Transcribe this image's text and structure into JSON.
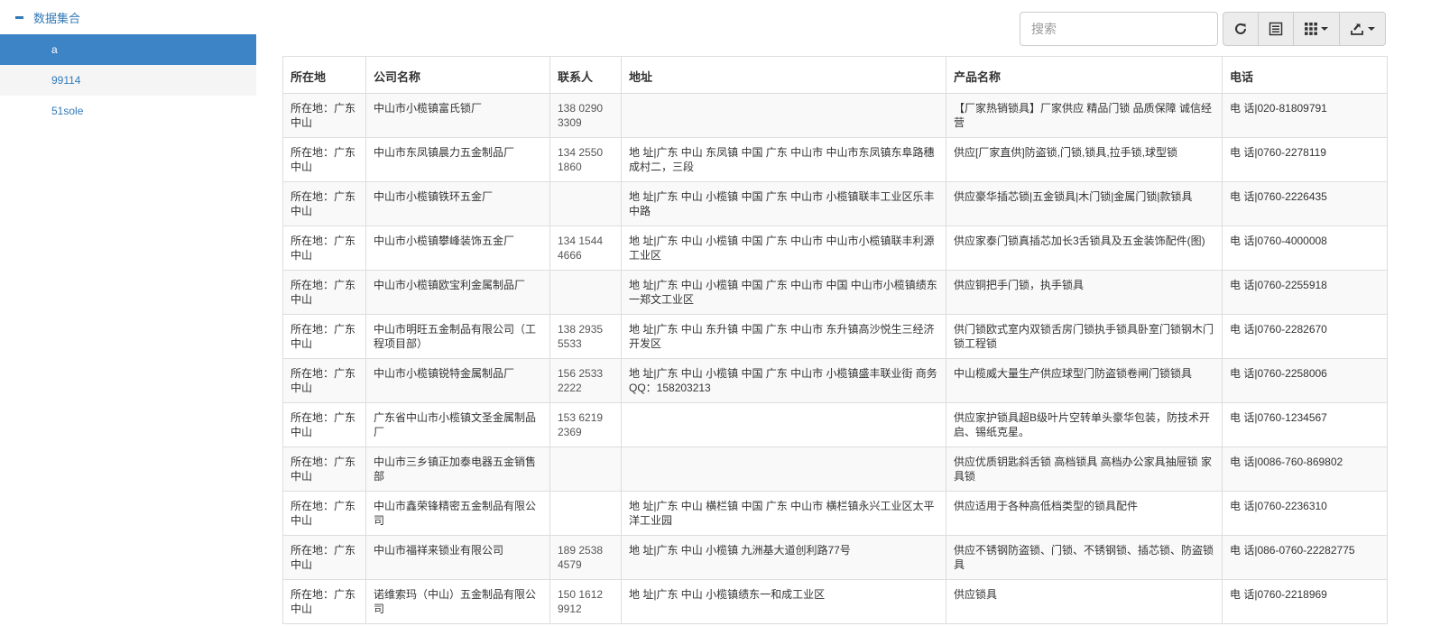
{
  "sidebar": {
    "root_label": "数据集合",
    "items": [
      {
        "label": "a"
      },
      {
        "label": "99114"
      },
      {
        "label": "51sole"
      }
    ]
  },
  "toolbar": {
    "search_placeholder": "搜索"
  },
  "table": {
    "columns": [
      "所在地",
      "公司名称",
      "联系人",
      "地址",
      "产品名称",
      "电话"
    ],
    "rows": [
      [
        "所在地：广东中山",
        "中山市小榄镇富氏锁厂",
        "138 0290 3309",
        "",
        "【厂家热销锁具】厂家供应 精品门锁 品质保障 诚信经营",
        "电 话|020-81809791"
      ],
      [
        "所在地：广东中山",
        "中山市东凤镇晨力五金制品厂",
        "134 2550 1860",
        "地 址|广东 中山 东凤镇 中国 广东 中山市 中山市东凤镇东阜路穗成村二，三段",
        "供应[厂家直供]防盗锁,门锁,锁具,拉手锁,球型锁",
        "电 话|0760-2278119"
      ],
      [
        "所在地：广东中山",
        "中山市小榄镇铁环五金厂",
        "",
        "地 址|广东 中山 小榄镇 中国 广东 中山市 小榄镇联丰工业区乐丰中路",
        "供应豪华插芯锁|五金锁具|木门锁|金属门锁|款锁具",
        "电 话|0760-2226435"
      ],
      [
        "所在地：广东中山",
        "中山市小榄镇攀峰装饰五金厂",
        "134 1544 4666",
        "地 址|广东 中山 小榄镇 中国 广东 中山市 中山市小榄镇联丰利源工业区",
        "供应家泰门锁真插芯加长3舌锁具及五金装饰配件(图)",
        "电 话|0760-4000008"
      ],
      [
        "所在地：广东中山",
        "中山市小榄镇欧宝利金属制品厂",
        "",
        "地 址|广东 中山 小榄镇 中国 广东 中山市 中国 中山市小榄镇绩东一郑文工业区",
        "供应铜把手门锁，执手锁具",
        "电 话|0760-2255918"
      ],
      [
        "所在地：广东中山",
        "中山市明旺五金制品有限公司（工程项目部）",
        "138 2935 5533",
        "地 址|广东 中山 东升镇 中国 广东 中山市 东升镇高沙悦生三经济开发区",
        "供门锁欧式室内双锁舌房门锁执手锁具卧室门锁钢木门锁工程锁",
        "电 话|0760-2282670"
      ],
      [
        "所在地：广东中山",
        "中山市小榄镇锐特金属制品厂",
        "156 2533 2222",
        "地 址|广东 中山 小榄镇 中国 广东 中山市 小榄镇盛丰联业街 商务QQ：158203213",
        "中山榄威大量生产供应球型门防盗锁卷闸门锁锁具",
        "电 话|0760-2258006"
      ],
      [
        "所在地：广东中山",
        "广东省中山市小榄镇文圣金属制品厂",
        "153 6219 2369",
        "",
        "供应家护锁具超B级叶片空转单头豪华包装，防技术开启、锡纸克星。",
        "电 话|0760-1234567"
      ],
      [
        "所在地：广东中山",
        "中山市三乡镇正加泰电器五金销售部",
        "",
        "",
        "供应优质钥匙斜舌锁 高档锁具 高档办公家具抽屉锁 家具锁",
        "电 话|0086-760-869802"
      ],
      [
        "所在地：广东中山",
        "中山市鑫荣锋精密五金制品有限公司",
        "",
        "地 址|广东 中山 横栏镇 中国 广东 中山市 横栏镇永兴工业区太平洋工业园",
        "供应适用于各种高低档类型的锁具配件",
        "电 话|0760-2236310"
      ],
      [
        "所在地：广东中山",
        "中山市福祥来锁业有限公司",
        "189 2538 4579",
        "地 址|广东 中山 小榄镇 九洲基大道创利路77号",
        "供应不锈钢防盗锁、门锁、不锈钢锁、插芯锁、防盗锁具",
        "电 话|086-0760-22282775"
      ],
      [
        "所在地：广东中山",
        "诺维索玛（中山）五金制品有限公司",
        "150 1612 9912",
        "地 址|广东 中山 小榄镇绩东一和成工业区",
        "供应锁具",
        "电 话|0760-2218969"
      ]
    ]
  }
}
